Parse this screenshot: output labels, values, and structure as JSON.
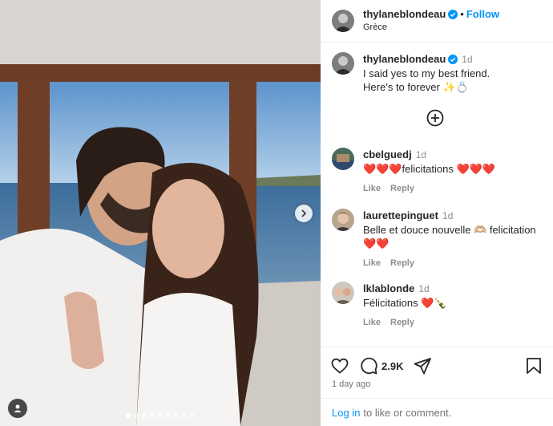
{
  "post": {
    "author": "thylaneblondeau",
    "follow_label": "Follow",
    "location": "Grèce",
    "caption_time": "1d",
    "caption_line1": "I said yes to my best friend.",
    "caption_line2": "Here’s to forever ✨💍"
  },
  "comments": [
    {
      "user": "cbelguedj",
      "time": "1d",
      "text": "❤️❤️❤️felicitations ❤️❤️❤️",
      "like": "Like",
      "reply": "Reply"
    },
    {
      "user": "laurettepinguet",
      "time": "1d",
      "text": "Belle et douce nouvelle 🫶🏼 felicitation",
      "text2": "❤️❤️",
      "like": "Like",
      "reply": "Reply"
    },
    {
      "user": "lklablonde",
      "time": "1d",
      "text": "Félicitations ❤️🍾",
      "like": "Like",
      "reply": "Reply"
    }
  ],
  "footer": {
    "comment_count": "2.9K",
    "posted": "1 day ago",
    "login_link": "Log in",
    "login_rest": "to like or comment."
  },
  "carousel": {
    "slides": 9,
    "active": 1
  },
  "colors": {
    "accent": "#0095f6",
    "verified": "#0095f6",
    "heart": "#e02238"
  },
  "icons": [
    "verified-badge-icon",
    "plus-circle-icon",
    "heart-icon",
    "comment-icon",
    "share-icon",
    "bookmark-icon",
    "chevron-right-icon",
    "user-tag-icon"
  ]
}
